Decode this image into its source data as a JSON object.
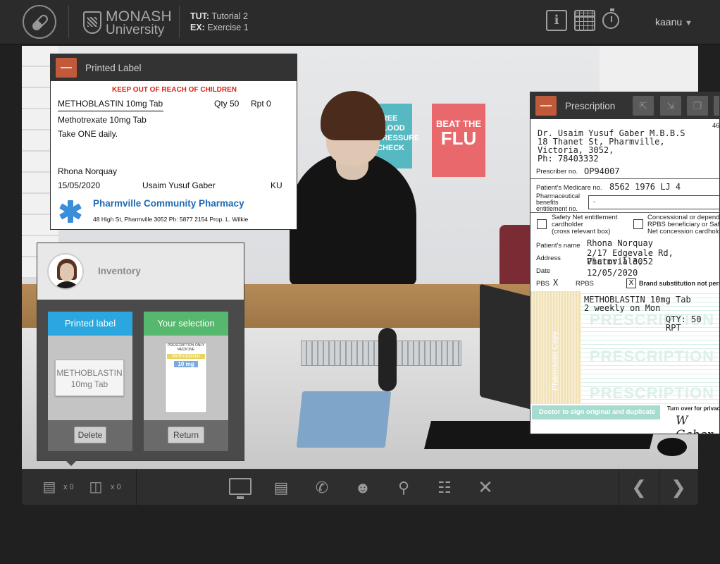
{
  "header": {
    "university_line1": "MONASH",
    "university_line2": "University",
    "tut_label": "TUT:",
    "tut_value": "Tutorial 2",
    "ex_label": "EX:",
    "ex_value": "Exercise 1",
    "info_icon_text": "i",
    "user": "kaanu",
    "icons": [
      "pill-logo-icon",
      "monash-crest-icon",
      "info-icon",
      "calendar-icon",
      "stopwatch-icon",
      "dropdown-arrow-icon"
    ]
  },
  "scene": {
    "poster1": "FREE BLOOD PRESSURE CHECK",
    "poster2_line1": "BEAT THE",
    "poster2_line2": "FLU"
  },
  "printed_label": {
    "title": "Printed Label",
    "warning": "KEEP OUT OF REACH OF CHILDREN",
    "drug": "METHOBLASTIN 10mg Tab",
    "qty": "Qty 50",
    "rpt": "Rpt 0",
    "generic": "Methotrexate 10mg Tab",
    "directions": "Take ONE daily.",
    "patient": "Rhona Norquay",
    "date": "15/05/2020",
    "prescriber": "Usaim Yusuf Gaber",
    "initials": "KU",
    "pharmacy": "Pharmville Community Pharmacy",
    "address": "48 High St, Pharmville 3052 Ph: 5877 2154 Prop. L. Wilkie"
  },
  "inventory": {
    "title": "Inventory",
    "col1_header": "Printed label",
    "col1_card_line1": "METHOBLASTIN",
    "col1_card_line2": "10mg Tab",
    "col1_button": "Delete",
    "col2_header": "Your selection",
    "col2_box_header": "PRESCRIPTION ONLY MEDICINE",
    "col2_box_name": "Methoblastin",
    "col2_box_strength": "10 mg",
    "col2_button": "Return",
    "colors": {
      "col1": "#2ba6df",
      "col2": "#55b86e"
    }
  },
  "prescription": {
    "title": "Prescription",
    "number_fragment": "46",
    "doctor_lines": [
      "Dr. Usaim Yusuf Gaber M.B.B.S",
      "18 Thanet St, Pharmville,",
      "Victoria, 3052,",
      "Ph: 78403332"
    ],
    "prescriber_no_label": "Prescriber no.",
    "prescriber_no": "OP94007",
    "medicare_label": "Patient's Medicare no.",
    "medicare_no": "8562 1976 LJ 4",
    "pbe_label_lines": [
      "Pharmaceutical",
      "benefits",
      "entitlement no."
    ],
    "pbe_value": "-",
    "safety_net_lines": [
      "Safety Net entitlement",
      "cardholder",
      "(cross relevant box)"
    ],
    "concessional_lines": [
      "Concessional or depend",
      "RPBS beneficiary or Saf",
      "Net concession cardhold"
    ],
    "patient_name_label": "Patient's name",
    "patient_name": "Rhona Norquay",
    "address_label": "Address",
    "address_lines": [
      "2/17 Edgevale Rd, Pharmville,",
      "Victoria 3052"
    ],
    "date_label": "Date",
    "date_value": "12/05/2020",
    "pbs_label": "PBS",
    "pbs_mark": "X",
    "rpbs_label": "RPBS",
    "brand_sub_mark": "X",
    "brand_sub_label": "Brand substitution not perr",
    "item_lines": [
      "METHOBLASTIN 10mg Tab",
      "2 weekly on Mon"
    ],
    "qty_line": "QTY: 50  RPT",
    "watermark": "PRESCRIPTION",
    "stamp_text": "Pharmacist Copy",
    "footer_green": "Doctor to sign original and duplicate",
    "turn_over": "Turn over for privacy",
    "signature": "W Gaber"
  },
  "toolbar": {
    "label_count": "x 0",
    "bottle_count": "x 0",
    "icons": [
      "label-stack-icon",
      "bottle-icon",
      "monitor-icon",
      "documents-icon",
      "phone-chat-icon",
      "patient-icon",
      "search-document-icon",
      "clipboard-icon",
      "close-icon",
      "previous-arrow-icon",
      "next-arrow-icon"
    ]
  }
}
